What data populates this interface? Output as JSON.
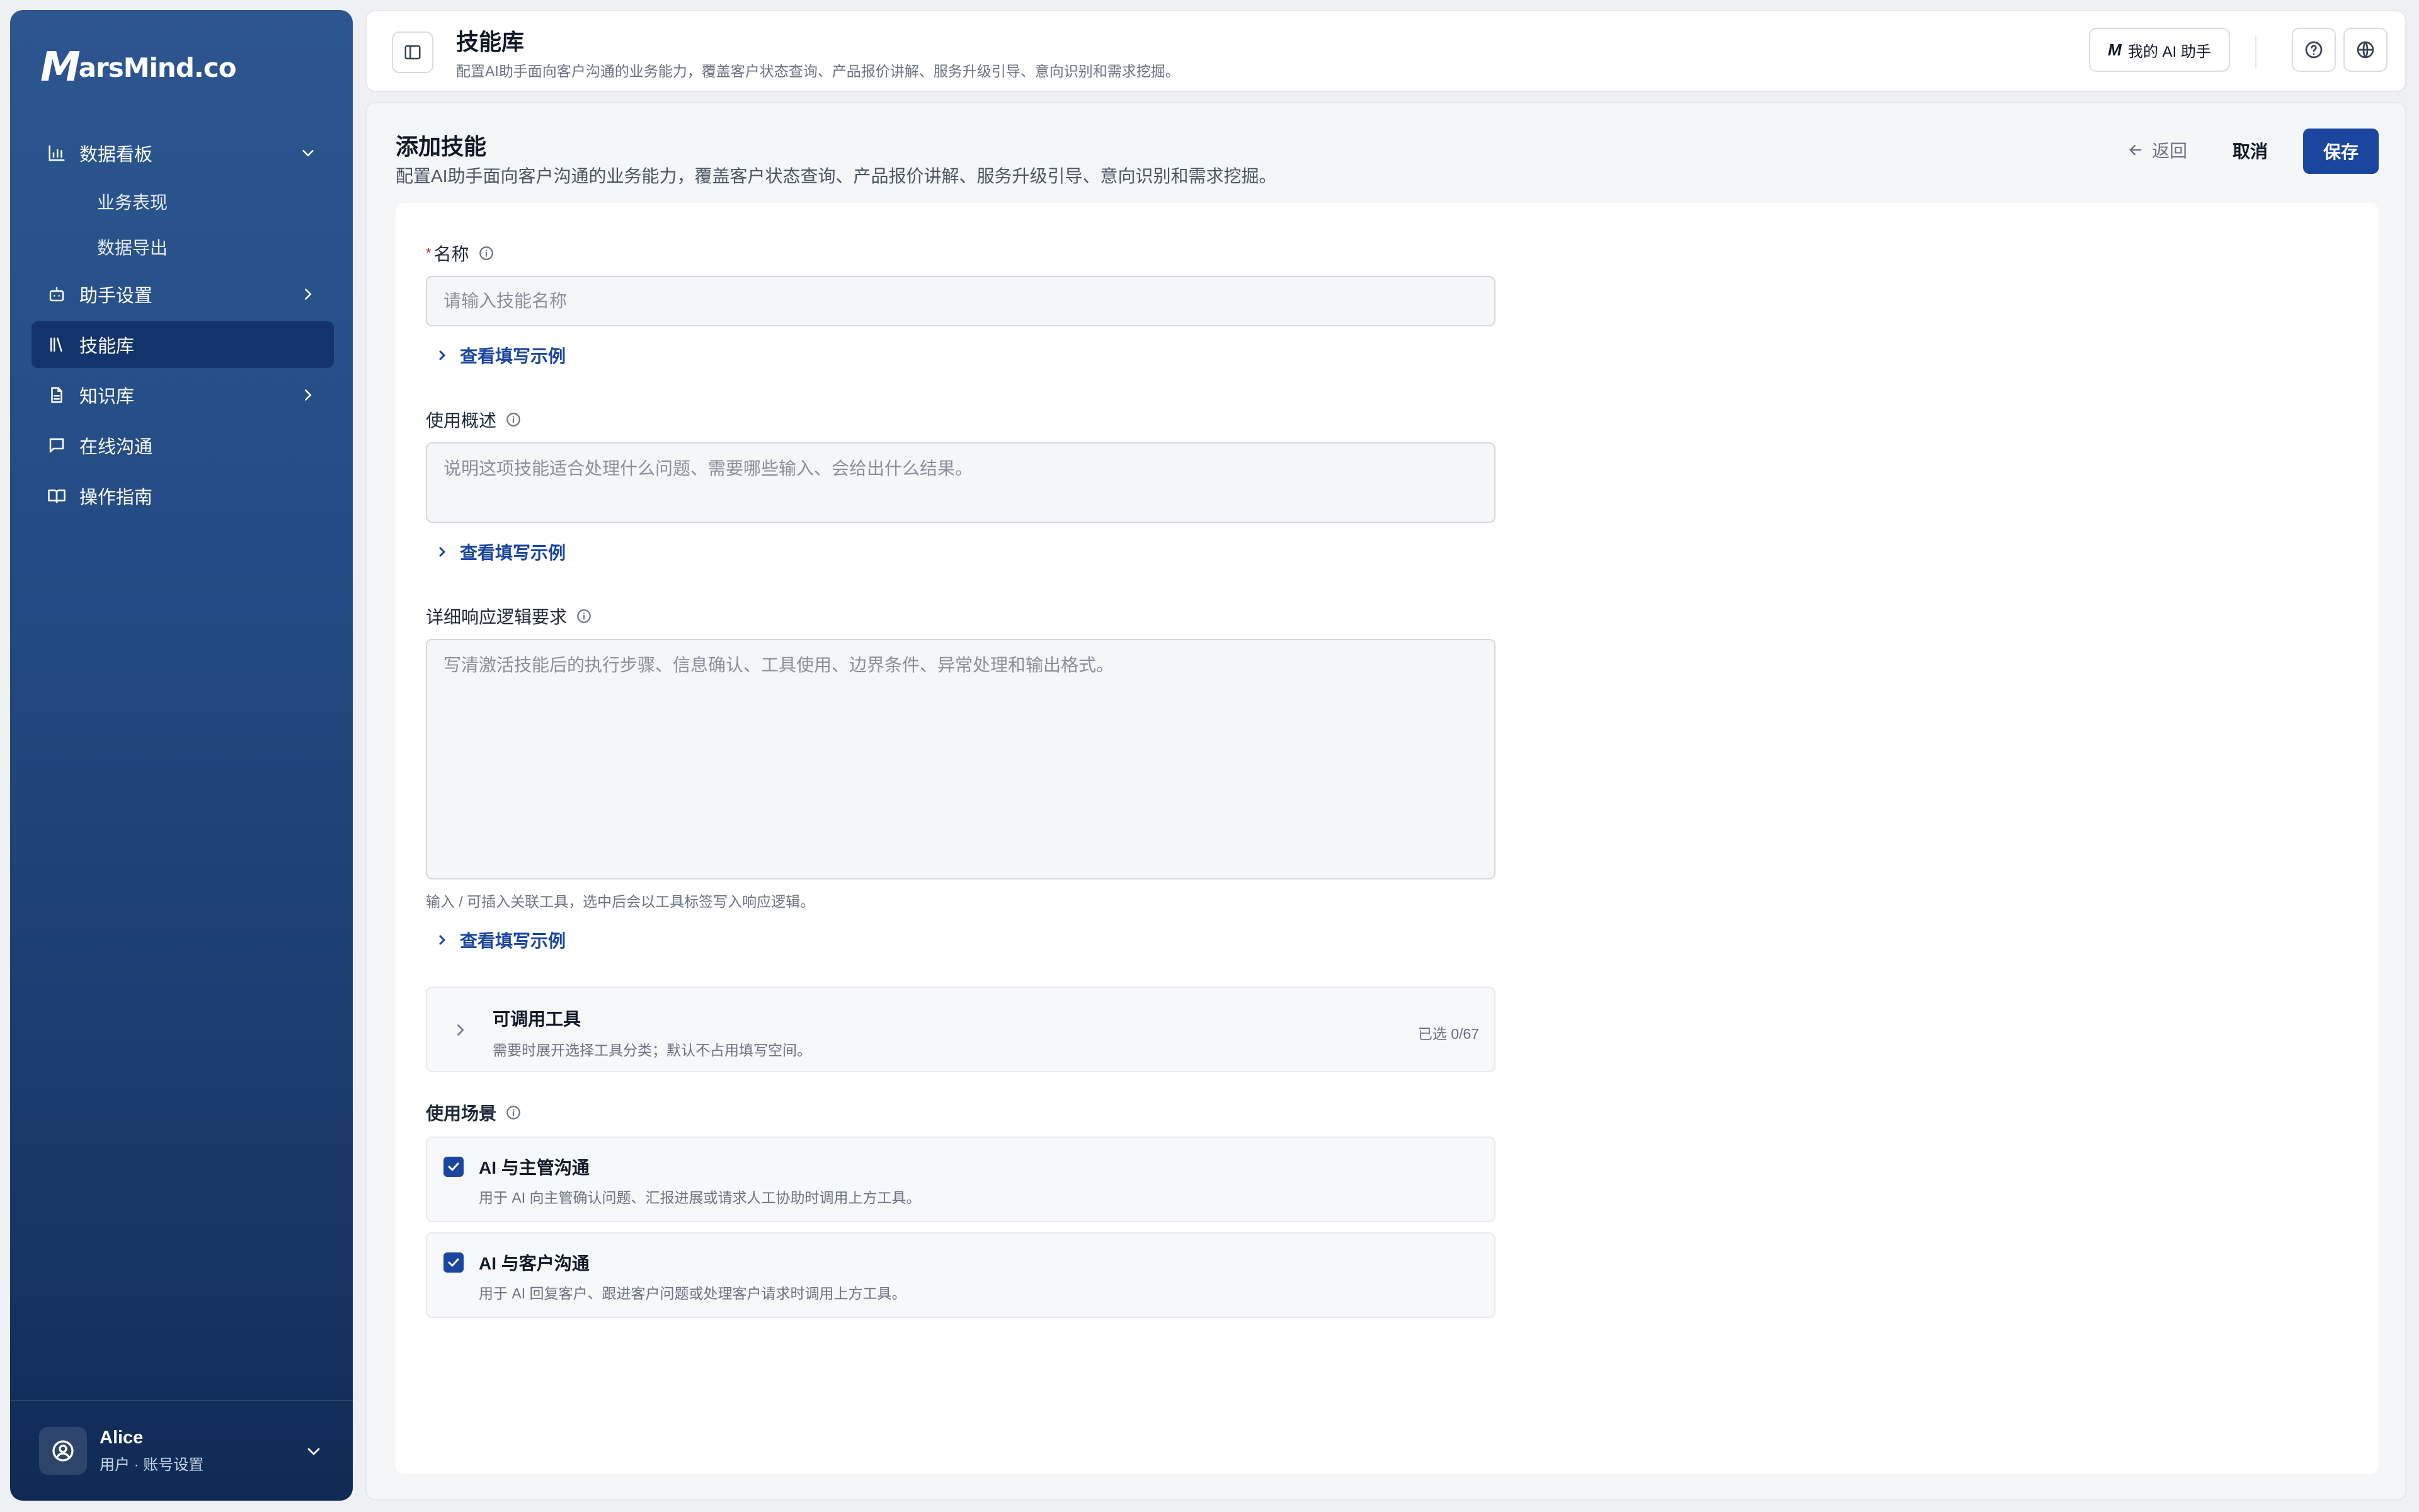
{
  "sidebar": {
    "logo": {
      "mark": "M",
      "text": "arsMind.co"
    },
    "items": [
      {
        "label": "数据看板",
        "icon": "bar-chart-icon",
        "expanded": true
      },
      {
        "label": "业务表现"
      },
      {
        "label": "数据导出"
      },
      {
        "label": "助手设置",
        "icon": "robot-icon"
      },
      {
        "label": "技能库",
        "icon": "library-icon",
        "active": true
      },
      {
        "label": "知识库",
        "icon": "document-icon"
      },
      {
        "label": "在线沟通",
        "icon": "chat-icon"
      },
      {
        "label": "操作指南",
        "icon": "book-icon"
      }
    ],
    "user": {
      "name": "Alice",
      "sub": "用户 · 账号设置"
    }
  },
  "header": {
    "title": "技能库",
    "subtitle": "配置AI助手面向客户沟通的业务能力，覆盖客户状态查询、产品报价讲解、服务升级引导、意向识别和需求挖掘。",
    "ai_button": {
      "mark": "M",
      "label": "我的 AI 助手"
    }
  },
  "page": {
    "title": "添加技能",
    "subtitle": "配置AI助手面向客户沟通的业务能力，覆盖客户状态查询、产品报价讲解、服务升级引导、意向识别和需求挖掘。",
    "back_label": "返回",
    "cancel_label": "取消",
    "save_label": "保存"
  },
  "form": {
    "name": {
      "required_mark": "*",
      "label": "名称",
      "placeholder": "请输入技能名称",
      "example": "查看填写示例"
    },
    "summary": {
      "label": "使用概述",
      "placeholder": "说明这项技能适合处理什么问题、需要哪些输入、会给出什么结果。",
      "example": "查看填写示例"
    },
    "logic": {
      "label": "详细响应逻辑要求",
      "placeholder": "写清激活技能后的执行步骤、信息确认、工具使用、边界条件、异常处理和输出格式。",
      "hint": "输入 / 可插入关联工具，选中后会以工具标签写入响应逻辑。",
      "example": "查看填写示例"
    },
    "tools": {
      "title": "可调用工具",
      "subtitle": "需要时展开选择工具分类；默认不占用填写空间。",
      "count": "已选 0/67"
    },
    "scenes": {
      "label": "使用场景",
      "items": [
        {
          "title": "AI 与主管沟通",
          "desc": "用于 AI 向主管确认问题、汇报进展或请求人工协助时调用上方工具。",
          "checked": true
        },
        {
          "title": "AI 与客户沟通",
          "desc": "用于 AI 回复客户、跟进客户问题或处理客户请求时调用上方工具。",
          "checked": true
        }
      ]
    }
  },
  "colors": {
    "accent": "#1a46a0",
    "sidebar_top": "#2d5690",
    "sidebar_bottom": "#102a55",
    "required": "#dc2626"
  }
}
